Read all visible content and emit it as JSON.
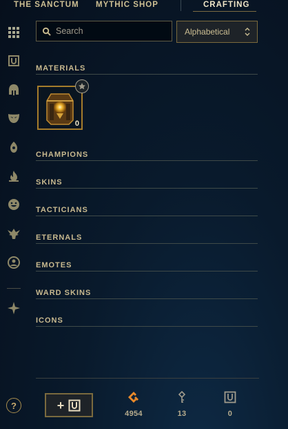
{
  "top_nav": {
    "tabs": [
      {
        "label": "THE SANCTUM"
      },
      {
        "label": "MYTHIC SHOP"
      },
      {
        "label": "CRAFTING"
      }
    ],
    "active_tab": "CRAFTING"
  },
  "sidebar": {
    "items": [
      {
        "icon": "grid-icon"
      },
      {
        "icon": "chest-icon"
      },
      {
        "icon": "helmet-icon"
      },
      {
        "icon": "mask-icon"
      },
      {
        "icon": "ward-icon"
      },
      {
        "icon": "flame-icon"
      },
      {
        "icon": "emote-face-icon"
      },
      {
        "icon": "eternals-icon"
      },
      {
        "icon": "summoner-icon"
      },
      {
        "icon": "tft-icon"
      }
    ]
  },
  "search": {
    "placeholder": "Search"
  },
  "sort": {
    "selected": "Alphabetical"
  },
  "sections": [
    {
      "label": "MATERIALS"
    },
    {
      "label": "CHAMPIONS"
    },
    {
      "label": "SKINS"
    },
    {
      "label": "TACTICIANS"
    },
    {
      "label": "ETERNALS"
    },
    {
      "label": "EMOTES"
    },
    {
      "label": "WARD SKINS"
    },
    {
      "label": "ICONS"
    }
  ],
  "materials": [
    {
      "icon": "chest-icon",
      "count": "0",
      "badge_icon": "star-icon"
    }
  ],
  "bottom": {
    "help_label": "?",
    "add_button_label": "+",
    "currencies": [
      {
        "icon": "orange-essence-icon",
        "value": "4954"
      },
      {
        "icon": "key-icon",
        "value": "13"
      },
      {
        "icon": "chest-icon",
        "value": "0"
      }
    ]
  },
  "colors": {
    "gold_text": "#c8b98f",
    "gold_border": "#a57c2b",
    "orange_essence": "#e8892a",
    "background": "#091a2c"
  }
}
